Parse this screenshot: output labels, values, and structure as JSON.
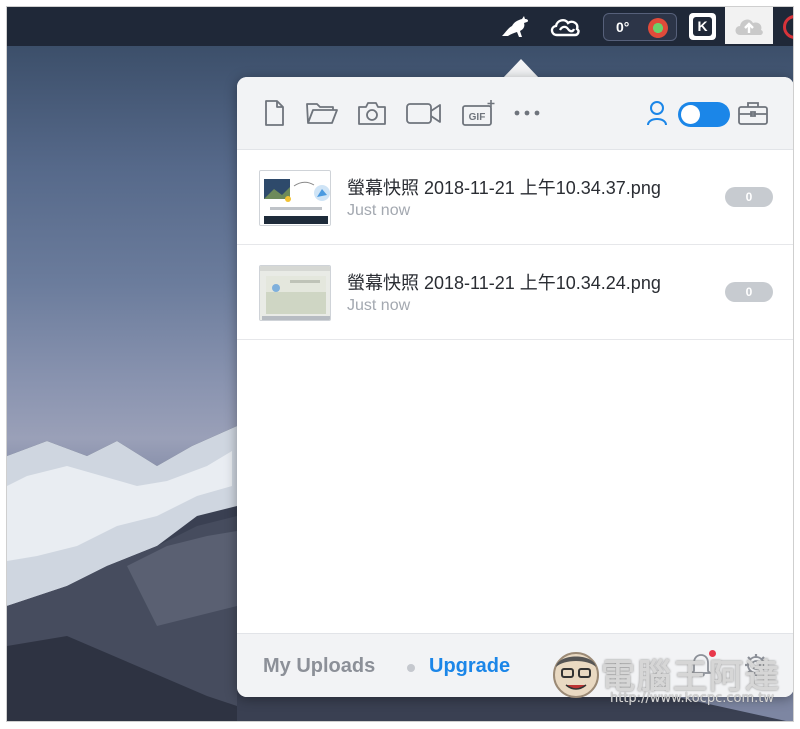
{
  "menubar": {
    "temperature": "0°",
    "k_letter": "K",
    "icons": [
      "kangaroo-icon",
      "creative-cloud-icon",
      "weather-icon",
      "k-app-icon",
      "cloud-upload-icon",
      "record-icon"
    ]
  },
  "toolbar": {
    "gif_label": "GIF",
    "buttons": [
      "new-file-icon",
      "open-folder-icon",
      "camera-icon",
      "video-icon",
      "gif-icon",
      "more-icon",
      "user-icon",
      "toggle-switch",
      "briefcase-icon"
    ],
    "toggle_on": true
  },
  "uploads": [
    {
      "filename": "螢幕快照 2018-11-21 上午10.34.37.png",
      "time": "Just now",
      "count": "0"
    },
    {
      "filename": "螢幕快照 2018-11-21 上午10.34.24.png",
      "time": "Just now",
      "count": "0"
    }
  ],
  "footer": {
    "my_uploads": "My Uploads",
    "upgrade": "Upgrade"
  },
  "watermark": {
    "title": "電腦王阿達",
    "url": "http://www.kocpc.com.tw"
  },
  "colors": {
    "accent": "#1b86e8",
    "menubar": "#1f2838",
    "badge": "#c7cbd0"
  }
}
